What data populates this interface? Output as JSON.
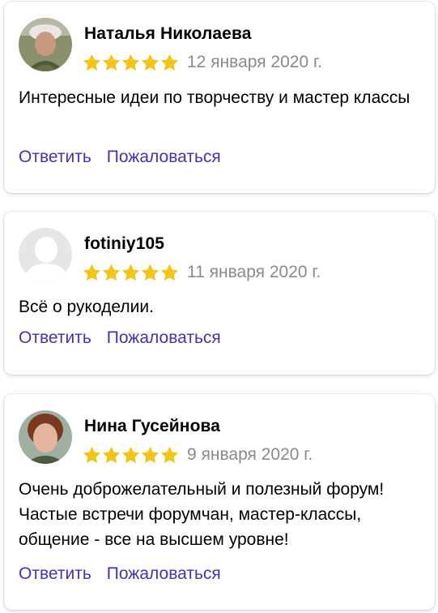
{
  "reviews": [
    {
      "author": "Наталья Николаева",
      "avatar": "user-photo",
      "rating": 5,
      "date": "12 января 2020 г.",
      "text": "Интересные идеи по творчеству и мастер классы",
      "reply_label": "Ответить",
      "complain_label": "Пожаловаться"
    },
    {
      "author": "fotiniy105",
      "avatar": "default-user-silhouette",
      "rating": 5,
      "date": "11 января 2020 г.",
      "text": "Всё о рукоделии.",
      "reply_label": "Ответить",
      "complain_label": "Пожаловаться"
    },
    {
      "author": "Нина Гусейнова",
      "avatar": "user-photo",
      "rating": 5,
      "date": "9 января 2020 г.",
      "text": "Очень доброжелательный и полезный форум! Частые встречи форумчан, мастер-классы, общение - все на высшем уровне!",
      "reply_label": "Ответить",
      "complain_label": "Пожаловаться"
    }
  ],
  "colors": {
    "star": "#f2c51a",
    "link": "#3f35b8",
    "date": "#8a8a8a"
  },
  "icons": {
    "star": "star-icon"
  }
}
